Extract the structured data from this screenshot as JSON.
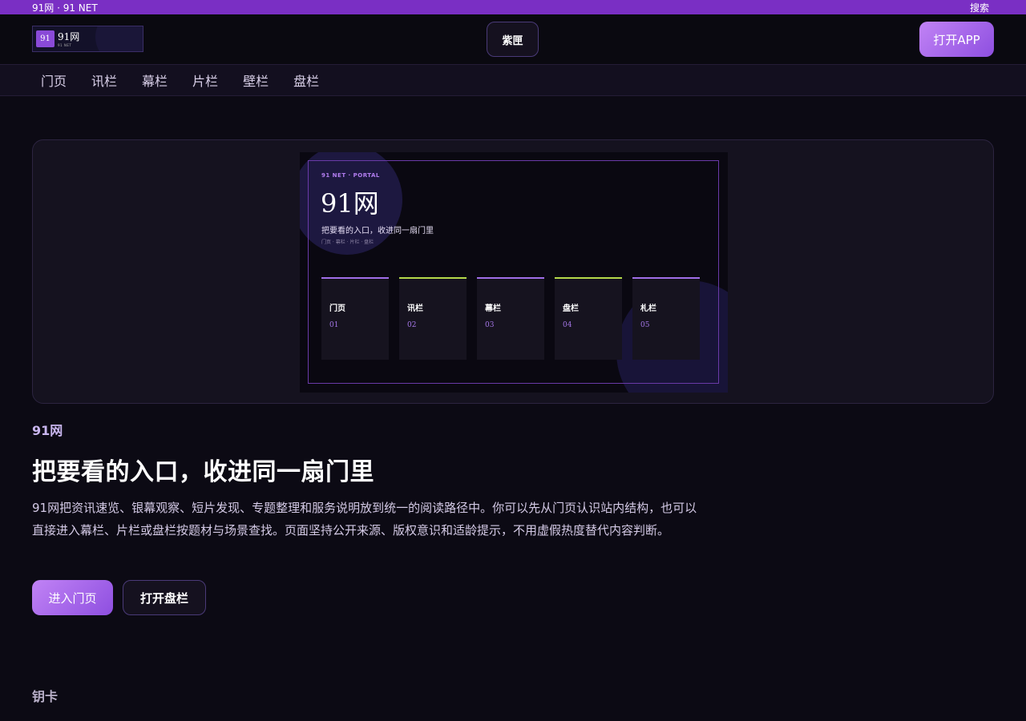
{
  "topbar": {
    "left_text": "91网 · 91 NET",
    "search_label": "搜索"
  },
  "header": {
    "logo_badge": "91",
    "logo_name": "91网",
    "logo_sub": "91 NET",
    "center_label": "紫匣",
    "app_button": "打开APP"
  },
  "nav": {
    "items": [
      "门页",
      "讯栏",
      "幕栏",
      "片栏",
      "壁栏",
      "盘栏"
    ]
  },
  "hero": {
    "kicker": "91 NET · PORTAL",
    "title": "91网",
    "subtitle": "把要看的入口，收进同一扇门里",
    "tiny": "门页 · 幕栏 · 片栏 · 盘栏",
    "cards": [
      {
        "title": "门页",
        "num": "01"
      },
      {
        "title": "讯栏",
        "num": "02"
      },
      {
        "title": "幕栏",
        "num": "03"
      },
      {
        "title": "盘栏",
        "num": "04"
      },
      {
        "title": "札栏",
        "num": "05"
      }
    ]
  },
  "intro": {
    "eyebrow": "91网",
    "headline": "把要看的入口，收进同一扇门里",
    "description": "91网把资讯速览、银幕观察、短片发现、专题整理和服务说明放到统一的阅读路径中。你可以先从门页认识站内结构，也可以直接进入幕栏、片栏或盘栏按题材与场景查找。页面坚持公开来源、版权意识和适龄提示，不用虚假热度替代内容判断。",
    "primary_button": "进入门页",
    "secondary_button": "打开盘栏"
  },
  "section": {
    "label": "钥卡"
  }
}
